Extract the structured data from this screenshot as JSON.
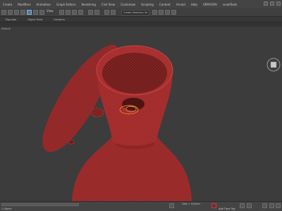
{
  "menubar": {
    "items": [
      "Create",
      "Modifiers",
      "Animation",
      "Graph Editors",
      "Rendering",
      "Civil View",
      "Customize",
      "Scripting",
      "Content",
      "Arnold",
      "Help",
      "VRAY/GPU",
      "scaleTools"
    ]
  },
  "toolbar": {
    "selection_set_placeholder": "Create Selection Se",
    "view_label": "View"
  },
  "ribbon": {
    "tabs": [
      "Populate",
      "Object Paint",
      "Freeform"
    ]
  },
  "viewport": {
    "label": "Default"
  },
  "status": {
    "left": "1 Object",
    "grid": "Grid = 10,0cm",
    "tag": "Add Time Tag"
  },
  "colors": {
    "model_red": "#9b2a2a",
    "model_highlight": "#c74646",
    "viewport_bg": "#3c3c3c"
  }
}
